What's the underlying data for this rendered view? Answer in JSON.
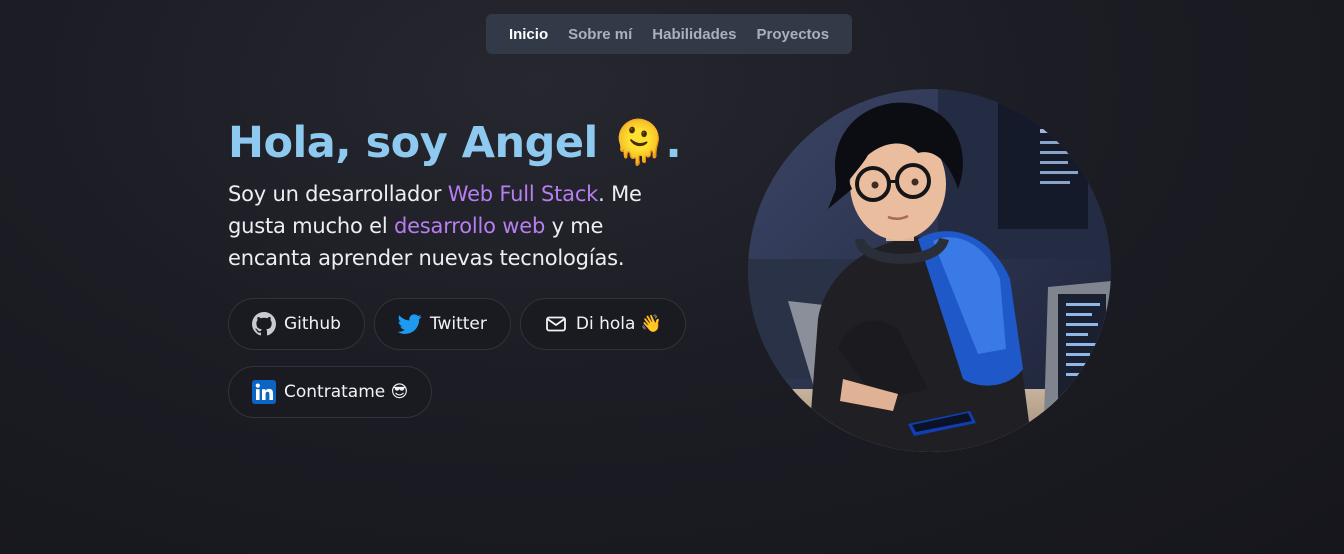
{
  "nav": {
    "items": [
      {
        "label": "Inicio",
        "active": true
      },
      {
        "label": "Sobre mí",
        "active": false
      },
      {
        "label": "Habilidades",
        "active": false
      },
      {
        "label": "Proyectos",
        "active": false
      }
    ]
  },
  "hero": {
    "greeting": "Hola, soy Angel",
    "greeting_emoji": "🫠",
    "greeting_end": ".",
    "bio_part1": "Soy un desarrollador ",
    "bio_highlight1": "Web Full Stack",
    "bio_part2": ". Me gusta mucho el ",
    "bio_highlight2": "desarrollo web",
    "bio_part3": " y me encanta aprender nuevas tecnologías."
  },
  "buttons": {
    "github": {
      "label": "Github",
      "icon": "github-icon"
    },
    "twitter": {
      "label": "Twitter",
      "icon": "twitter-icon"
    },
    "email": {
      "label": "Di hola 👋",
      "icon": "mail-icon"
    },
    "linkedin": {
      "label": "Contratame 😎",
      "icon": "linkedin-icon"
    }
  },
  "colors": {
    "greeting": "#8ecaf0",
    "highlight": "#b77ef0",
    "nav_bg": "#333a47",
    "twitter": "#1d9bf0",
    "linkedin": "#0a66c2"
  }
}
